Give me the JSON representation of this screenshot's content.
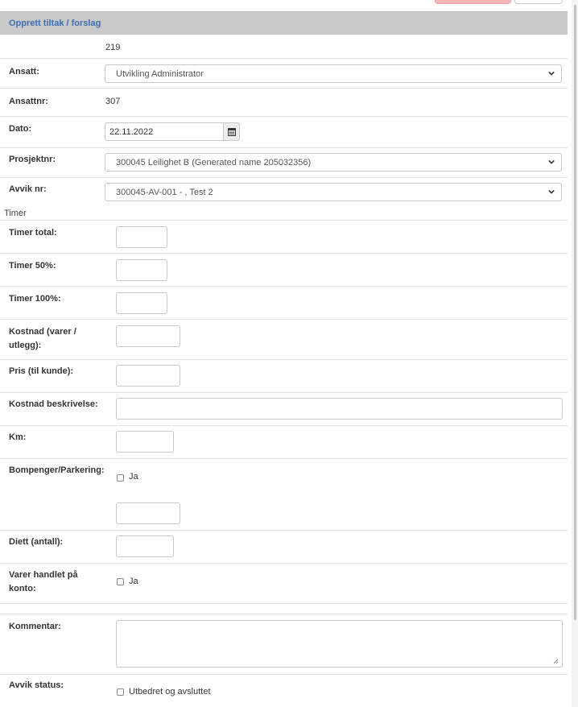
{
  "panel": {
    "title": "Opprett tiltak / forslag"
  },
  "record": {
    "id": "219"
  },
  "fields": {
    "ansatt": {
      "label": "Ansatt:",
      "value": "Utvikling Administrator"
    },
    "ansattnr": {
      "label": "Ansattnr:",
      "value": "307"
    },
    "dato": {
      "label": "Dato:",
      "value": "22.11.2022"
    },
    "prosjektnr": {
      "label": "Prosjektnr:",
      "value": "300045 Leilighet B (Generated name 205032356)"
    },
    "avvik_nr": {
      "label": "Avvik nr:",
      "value": "300045-AV-001 - , Test 2"
    }
  },
  "section_timer": "Timer",
  "timer": {
    "total_label": "Timer total:",
    "p50_label": "Timer 50%:",
    "p100_label": "Timer 100%:",
    "kostnad_label_1": "Kostnad (varer /",
    "kostnad_label_2": "utlegg):",
    "pris_label": "Pris (til kunde):",
    "kostnad_beskrivelse_label": "Kostnad beskrivelse:",
    "km_label": "Km:",
    "bompenger_label": "Bompenger/Parkering:",
    "bompenger_check": "Ja",
    "diett_label": "Diett (antall):",
    "varer_label_1": "Varer handlet på",
    "varer_label_2": "konto:",
    "varer_check": "Ja",
    "kommentar_label": "Kommentar:",
    "avvik_status_label": "Avvik status:",
    "avvik_status_check": "Utbedret og avsluttet"
  },
  "colors": {
    "header_bg": "#c9c9c9",
    "header_text": "#3b6fb6",
    "primary_button": "#f4b6b6"
  }
}
